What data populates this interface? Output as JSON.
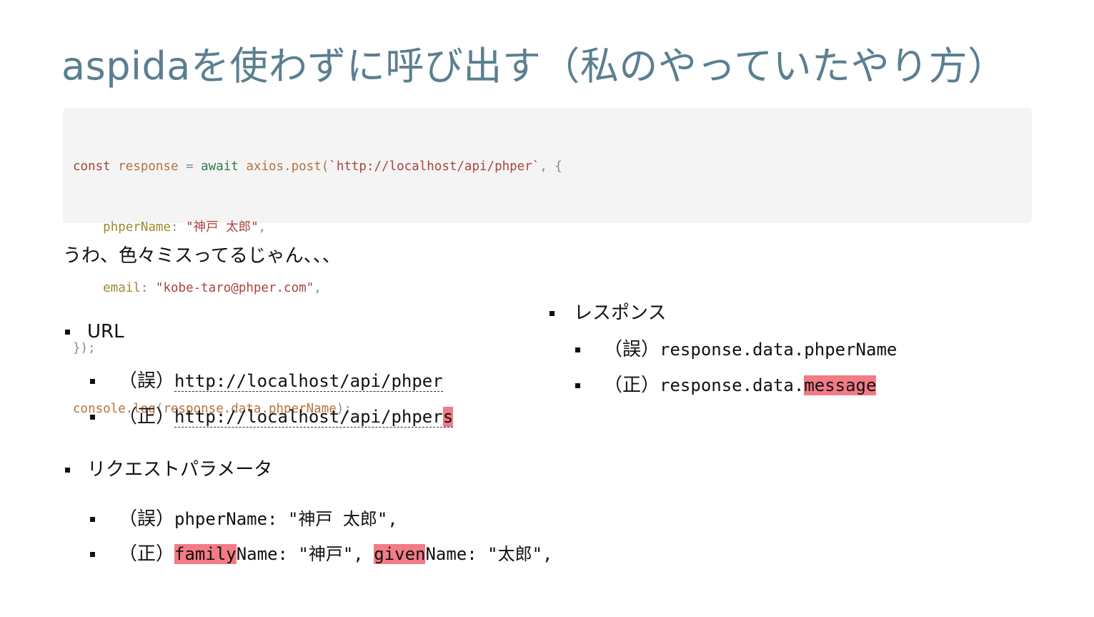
{
  "title": "aspidaを使わずに呼び出す（私のやっていたやり方）",
  "code": {
    "line1": {
      "kw": "const",
      "var": "response",
      "eq": " = ",
      "aw": "await",
      "fn": "axios.post(",
      "str": "`http://localhost/api/phper`",
      "tail": ", {"
    },
    "line2": {
      "prop": "phperName",
      "colon": ": ",
      "str": "\"神戸 太郎\"",
      "tail": ","
    },
    "line3": {
      "prop": "email",
      "colon": ": ",
      "str": "\"kobe-taro@phper.com\"",
      "tail": ","
    },
    "line4": {
      "text": "});"
    },
    "line5": {
      "fn": "console.log",
      "open": "(",
      "var": "response.data.phperName",
      "tail": ");"
    }
  },
  "note": "うわ、色々ミスってるじゃん、、、",
  "left": {
    "url": {
      "label": "URL",
      "wrong_prefix": "（誤）",
      "wrong_url": "http://localhost/api/phper",
      "right_prefix": "（正）",
      "right_url_base": "http://localhost/api/phper",
      "right_url_hl": "s"
    },
    "params": {
      "label": "リクエストパラメータ",
      "wrong_prefix": "（誤）",
      "wrong_text": "phperName: \"神戸 太郎\",",
      "right_prefix": "（正）",
      "right_hl1": "family",
      "right_mid": "Name: \"神戸\", ",
      "right_hl2": "given",
      "right_tail": "Name: \"太郎\","
    }
  },
  "right": {
    "label": "レスポンス",
    "wrong_prefix": "（誤）",
    "wrong_text": "response.data.phperName",
    "right_prefix": "（正）",
    "right_base": "response.data.",
    "right_hl": "message"
  },
  "colors": {
    "title": "#5a7f90",
    "highlight": "#f27b86",
    "code_bg": "#f4f4f4"
  }
}
